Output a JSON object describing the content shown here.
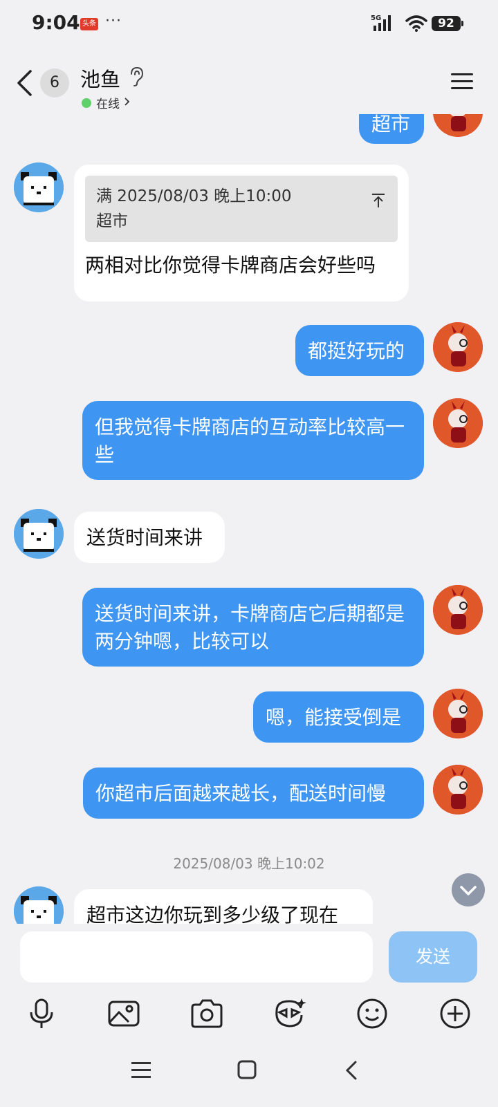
{
  "status_bar": {
    "time": "9:04",
    "app_badge": "头条",
    "dots": "···",
    "network": "5G",
    "battery": "92"
  },
  "header": {
    "unread_count": "6",
    "contact_name": "池鱼",
    "status": "在线"
  },
  "messages": [
    {
      "sender": "me",
      "text": "超市"
    },
    {
      "sender": "them",
      "quote_time": "满 2025/08/03 晚上10:00",
      "quote_text": "超市",
      "text": "两相对比你觉得卡牌商店会好些吗"
    },
    {
      "sender": "me",
      "text": "都挺好玩的"
    },
    {
      "sender": "me",
      "text": "但我觉得卡牌商店的互动率比较高一些"
    },
    {
      "sender": "them",
      "text": "送货时间来讲"
    },
    {
      "sender": "me",
      "text": "送货时间来讲，卡牌商店它后期都是两分钟嗯，比较可以"
    },
    {
      "sender": "me",
      "text": "嗯，能接受倒是"
    },
    {
      "sender": "me",
      "text": "你超市后面越来越长，配送时间慢"
    },
    {
      "sender": "them",
      "text": "超市这边你玩到多少级了现在"
    }
  ],
  "timestamp": "2025/08/03 晚上10:02",
  "input": {
    "value": "",
    "send_label": "发送"
  },
  "colors": {
    "my_bubble": "#3e95f2",
    "their_bubble": "#ffffff",
    "background": "#f1f1f3",
    "send_disabled": "#8ec4f5"
  },
  "toolbar_icons": [
    "microphone-icon",
    "image-icon",
    "camera-icon",
    "sticker-icon",
    "emoji-icon",
    "plus-icon"
  ]
}
